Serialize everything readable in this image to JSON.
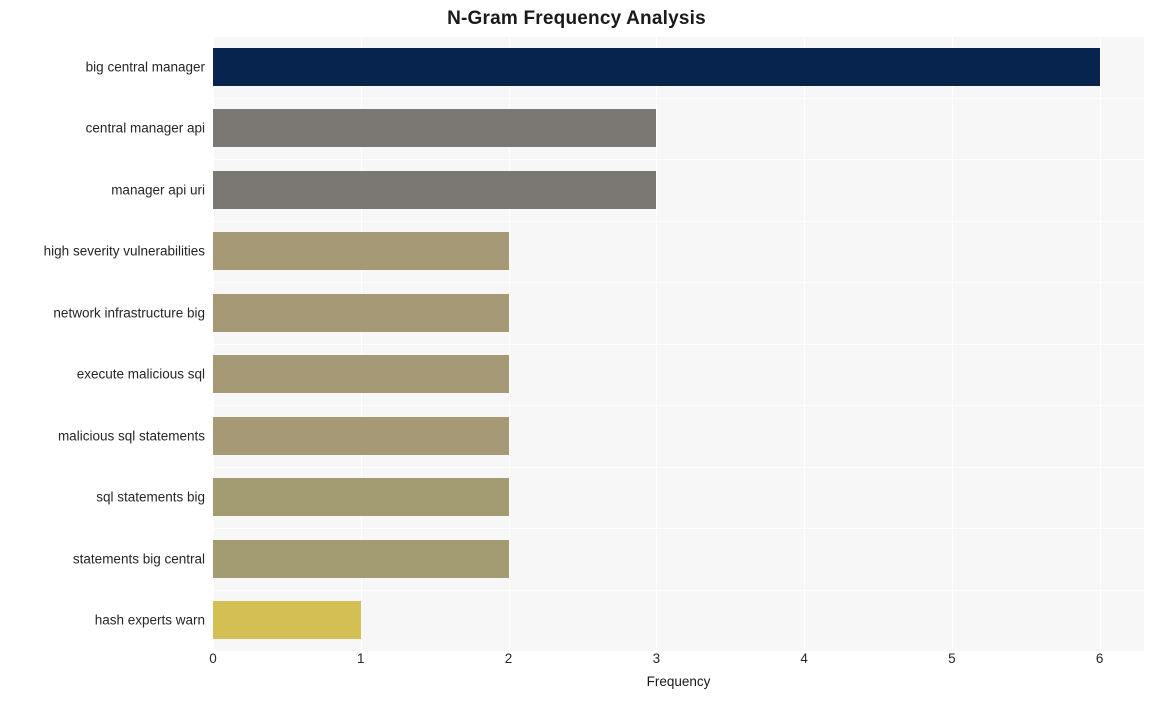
{
  "chart_data": {
    "type": "bar",
    "orientation": "horizontal",
    "title": "N-Gram Frequency Analysis",
    "xlabel": "Frequency",
    "ylabel": "",
    "xlim": [
      0,
      6.3
    ],
    "xticks": [
      0,
      1,
      2,
      3,
      4,
      5,
      6
    ],
    "xtick_labels": [
      "0",
      "1",
      "2",
      "3",
      "4",
      "5",
      "6"
    ],
    "grid": true,
    "legend": "none",
    "background": "#f7f7f7",
    "categories": [
      "big central manager",
      "central manager api",
      "manager api uri",
      "high severity vulnerabilities",
      "network infrastructure big",
      "execute malicious sql",
      "malicious sql statements",
      "sql statements big",
      "statements big central",
      "hash experts warn"
    ],
    "values": [
      6,
      3,
      3,
      2,
      2,
      2,
      2,
      2,
      2,
      1
    ],
    "bar_colors": [
      "#07244f",
      "#7b7874",
      "#7b7874",
      "#a59a75",
      "#a59a75",
      "#a59a75",
      "#a59a75",
      "#a39c72",
      "#a39c72",
      "#d4bf54"
    ]
  }
}
